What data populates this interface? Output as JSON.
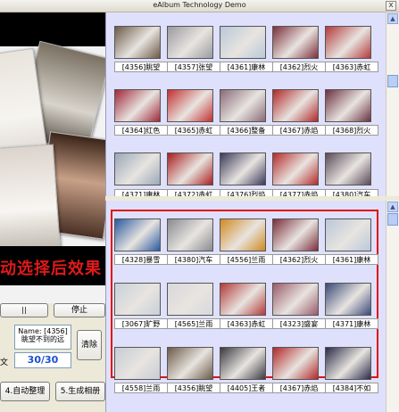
{
  "window": {
    "title": "eAlbum Technology Demo",
    "close_label": "x"
  },
  "preview": {
    "caption": "动选择后效果"
  },
  "top_grid": {
    "items": [
      {
        "label": "[4356]眺望",
        "color": "#6b5a48"
      },
      {
        "label": "[4357]张望",
        "color": "#9a9aa0"
      },
      {
        "label": "[4361]康林",
        "color": "#b9c8d8"
      },
      {
        "label": "[4362]烈火",
        "color": "#7a2e3a"
      },
      {
        "label": "[4363]赤虹",
        "color": "#b23a3a"
      },
      {
        "label": "[4364]红色",
        "color": "#a0283a"
      },
      {
        "label": "[4365]赤虹",
        "color": "#c23030"
      },
      {
        "label": "[4366]整备",
        "color": "#8a6a78"
      },
      {
        "label": "[4367]赤焰",
        "color": "#b02828"
      },
      {
        "label": "[4368]烈火",
        "color": "#6a3040"
      },
      {
        "label": "",
        "color": "#9aa8b8"
      },
      {
        "label": "",
        "color": "#a81e1e"
      },
      {
        "label": "",
        "color": "#3a3a5a"
      },
      {
        "label": "",
        "color": "#b42a2a"
      },
      {
        "label": "",
        "color": "#5a4a58"
      }
    ],
    "partial_labels": [
      "[4371]康林",
      "[4372]赤虹",
      "[4376]烈焰",
      "[4377]赤焰",
      "[4380]汽车"
    ]
  },
  "bottom_grid": {
    "items": [
      {
        "label": "[4328]暴雪",
        "color": "#2a5aa0"
      },
      {
        "label": "[4380]汽车",
        "color": "#8a8a90"
      },
      {
        "label": "[4556]兰雨",
        "color": "#d08a20"
      },
      {
        "label": "[4362]烈火",
        "color": "#7a2e3a"
      },
      {
        "label": "[4361]康林",
        "color": "#b9c8d8"
      },
      {
        "label": "[3067]旷野",
        "color": "#c8d0d8"
      },
      {
        "label": "[4565]兰雨",
        "color": "#d8d8dc"
      },
      {
        "label": "[4363]赤虹",
        "color": "#b23a3a"
      },
      {
        "label": "[4323]盛宴",
        "color": "#9a5a68"
      },
      {
        "label": "[4371]康林",
        "color": "#3a4a78"
      },
      {
        "label": "[4558]兰雨",
        "color": "#c8ccd4"
      },
      {
        "label": "[4356]眺望",
        "color": "#6b5a48"
      },
      {
        "label": "[4405]王者",
        "color": "#3a3a40"
      },
      {
        "label": "[4367]赤焰",
        "color": "#b02828"
      },
      {
        "label": "[4384]不如",
        "color": "#2a2a48"
      }
    ]
  },
  "controls": {
    "pause_label": "||",
    "stop_label": "停止",
    "name_line": "Name: [4356]眺望不到的远",
    "count": "30/30",
    "side_char": "文",
    "clear_label": "清除",
    "auto_label": "4.自动整理",
    "generate_label": "5.生成相册"
  }
}
